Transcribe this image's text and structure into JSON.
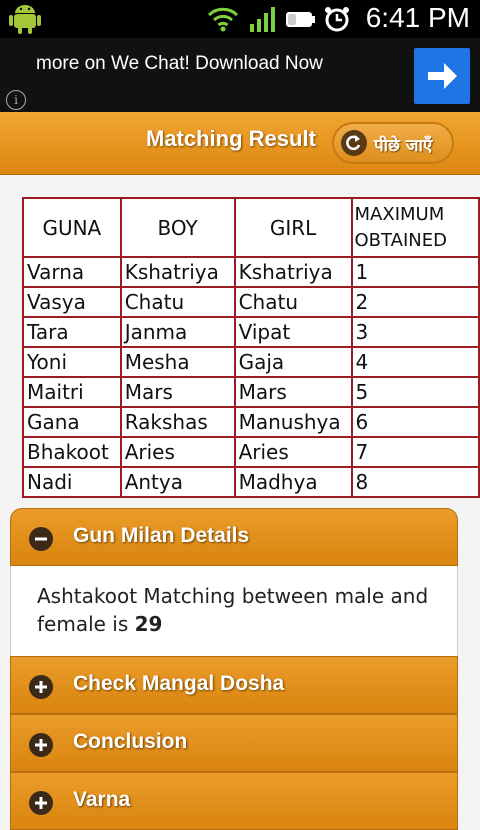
{
  "status_bar": {
    "time": "6:41 PM",
    "icons": [
      "android-icon",
      "wifi-icon",
      "signal-icon",
      "battery-icon",
      "alarm-icon"
    ]
  },
  "ad": {
    "text": "more on We Chat! Download Now",
    "info_icon": "i",
    "cta_icon": "arrow-right-icon"
  },
  "header": {
    "title": "Matching Result",
    "back_label": "पीछे जाएँ"
  },
  "table": {
    "headers": [
      "GUNA",
      "BOY",
      "GIRL",
      "MAXIMUM OBTAINED"
    ],
    "header_max_line1": "MAXIMUM",
    "header_max_line2": "OBTAINED",
    "rows": [
      [
        "Varna",
        "Kshatriya",
        "Kshatriya",
        "1"
      ],
      [
        "Vasya",
        "Chatu",
        "Chatu",
        "2"
      ],
      [
        "Tara",
        "Janma",
        "Vipat",
        "3"
      ],
      [
        "Yoni",
        "Mesha",
        "Gaja",
        "4"
      ],
      [
        "Maitri",
        "Mars",
        "Mars",
        "5"
      ],
      [
        "Gana",
        "Rakshas",
        "Manushya",
        "6"
      ],
      [
        "Bhakoot",
        "Aries",
        "Aries",
        "7"
      ],
      [
        "Nadi",
        "Antya",
        "Madhya",
        "8"
      ]
    ]
  },
  "accordion": {
    "sections": [
      {
        "label": "Gun Milan Details",
        "expanded": true,
        "icon": "minus-icon"
      },
      {
        "label": "Check Mangal Dosha",
        "expanded": false,
        "icon": "plus-icon"
      },
      {
        "label": "Conclusion",
        "expanded": false,
        "icon": "plus-icon"
      },
      {
        "label": "Varna",
        "expanded": false,
        "icon": "plus-icon"
      }
    ],
    "details_text": "Ashtakoot Matching between male and female is",
    "details_score": "29"
  },
  "colors": {
    "accent": "#e0900f",
    "table_border": "#9b1b25",
    "ad_button": "#1e75e6"
  }
}
